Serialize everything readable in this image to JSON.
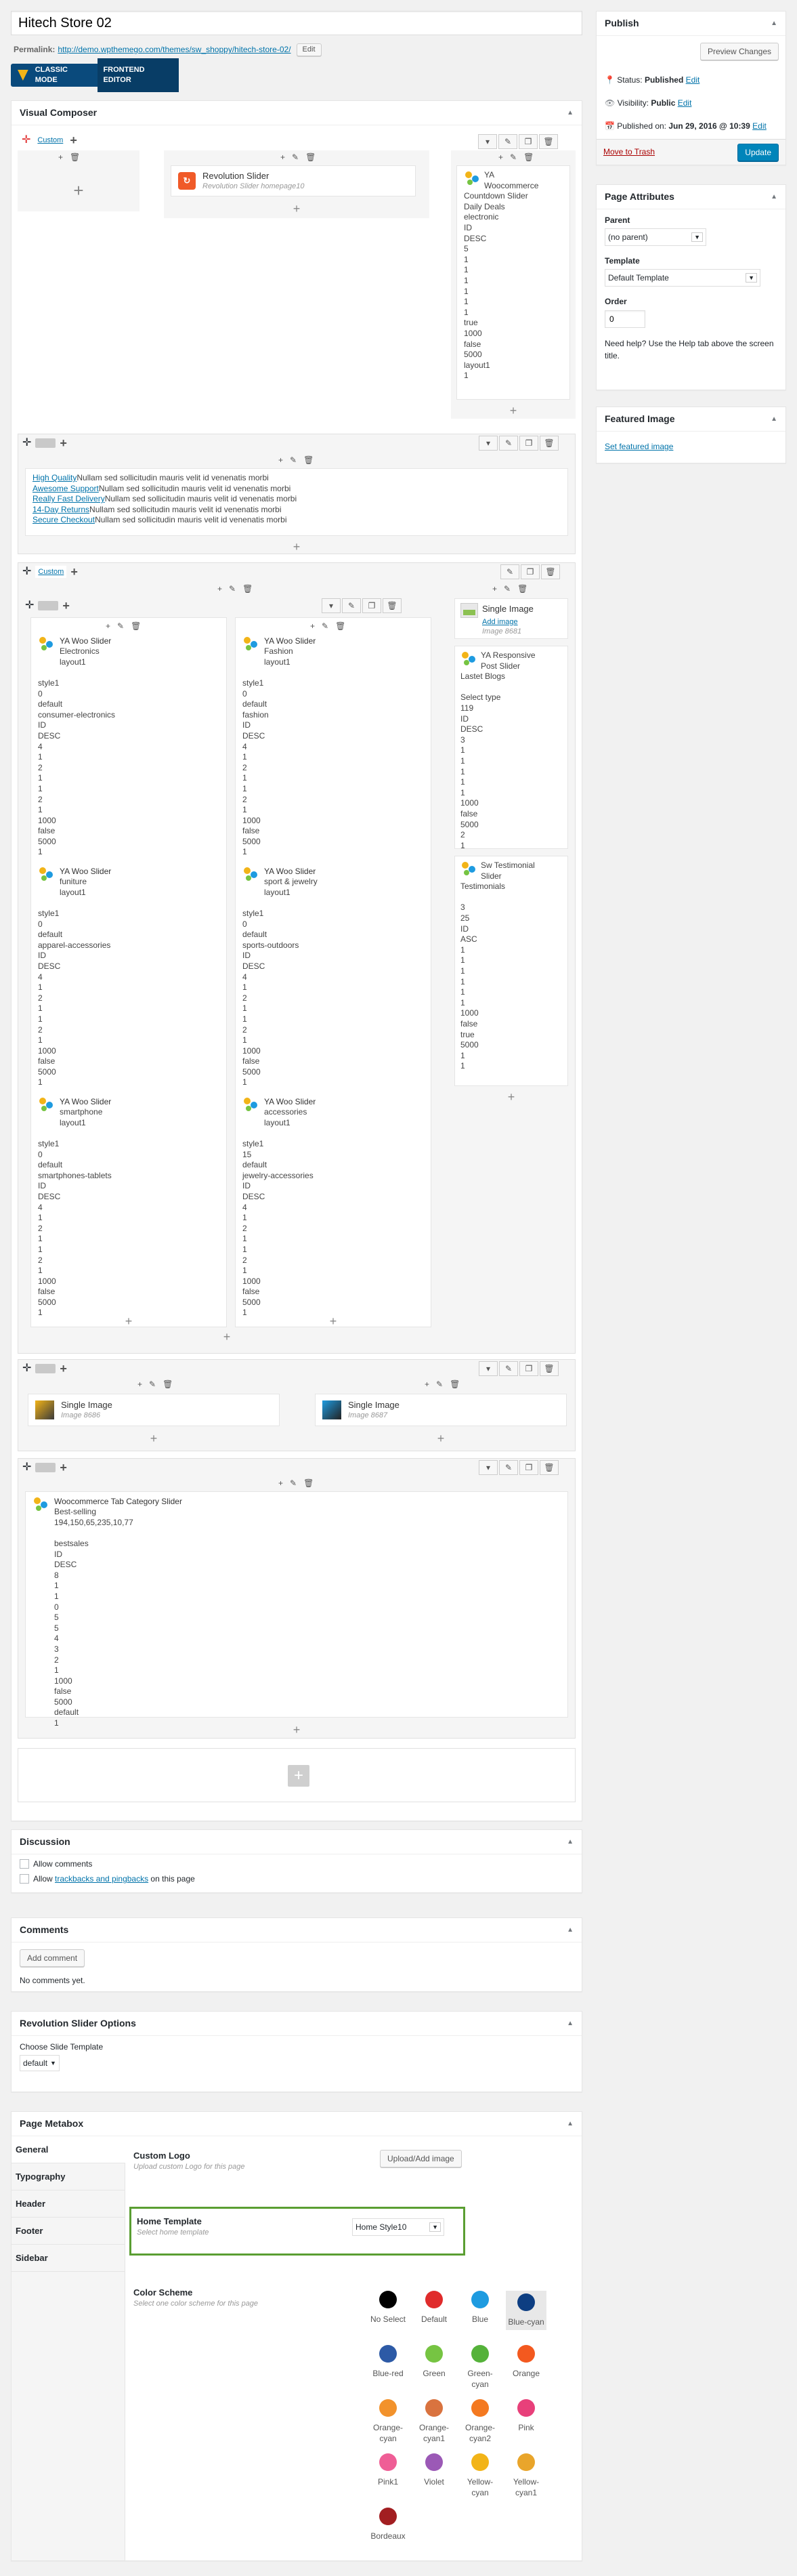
{
  "title": "Hitech Store 02",
  "permalink": {
    "label": "Permalink:",
    "url": "http://demo.wpthemego.com/themes/sw_shoppy/hitech-store-02/",
    "edit": "Edit"
  },
  "modes": {
    "classic": "CLASSIC MODE",
    "frontend": "FRONTEND EDITOR"
  },
  "vc": {
    "title": "Visual Composer",
    "custom": "Custom"
  },
  "row1": {
    "rev": {
      "name": "Revolution Slider",
      "desc": "Revolution Slider homepage10"
    },
    "countdown": {
      "lines": [
        "YA",
        "Woocommerce",
        "Countdown Slider",
        "Daily Deals",
        "electronic",
        "ID",
        "DESC",
        "5",
        "1",
        "1",
        "1",
        "1",
        "1",
        "1",
        "true",
        "1000",
        "false",
        "5000",
        "layout1",
        "1"
      ]
    }
  },
  "row2": {
    "links": [
      {
        "link": "High Quality",
        "text": "Nullam sed sollicitudin mauris velit id venenatis morbi"
      },
      {
        "link": "Awesome Support",
        "text": "Nullam sed sollicitudin mauris velit id venenatis morbi"
      },
      {
        "link": "Really Fast Delivery",
        "text": "Nullam sed sollicitudin mauris velit id venenatis morbi"
      },
      {
        "link": "14-Day Returns",
        "text": "Nullam sed sollicitudin mauris velit id venenatis morbi"
      },
      {
        "link": "Secure Checkout",
        "text": "Nullam sed sollicitudin mauris velit id venenatis morbi"
      }
    ]
  },
  "row3": {
    "custom": "Custom",
    "sliders": [
      {
        "title": "YA Woo Slider",
        "lines": [
          "Electronics",
          "layout1",
          "",
          "style1",
          "0",
          "default",
          "consumer-electronics",
          "ID",
          "DESC",
          "4",
          "1",
          "2",
          "1",
          "1",
          "2",
          "1",
          "1000",
          "false",
          "5000",
          "1"
        ]
      },
      {
        "title": "YA Woo Slider",
        "lines": [
          "Fashion",
          "layout1",
          "",
          "style1",
          "0",
          "default",
          "fashion",
          "ID",
          "DESC",
          "4",
          "1",
          "2",
          "1",
          "1",
          "2",
          "1",
          "1000",
          "false",
          "5000",
          "1"
        ]
      },
      {
        "title": "YA Woo Slider",
        "lines": [
          "funiture",
          "layout1",
          "",
          "style1",
          "0",
          "default",
          "apparel-accessories",
          "ID",
          "DESC",
          "4",
          "1",
          "2",
          "1",
          "1",
          "2",
          "1",
          "1000",
          "false",
          "5000",
          "1"
        ]
      },
      {
        "title": "YA Woo Slider",
        "lines": [
          "sport & jewelry",
          "layout1",
          "",
          "style1",
          "0",
          "default",
          "sports-outdoors",
          "ID",
          "DESC",
          "4",
          "1",
          "2",
          "1",
          "1",
          "2",
          "1",
          "1000",
          "false",
          "5000",
          "1"
        ]
      },
      {
        "title": "YA Woo Slider",
        "lines": [
          "smartphone",
          "layout1",
          "",
          "style1",
          "0",
          "default",
          "smartphones-tablets",
          "ID",
          "DESC",
          "4",
          "1",
          "2",
          "1",
          "1",
          "2",
          "1",
          "1000",
          "false",
          "5000",
          "1"
        ]
      },
      {
        "title": "YA Woo Slider",
        "lines": [
          "accessories",
          "layout1",
          "",
          "style1",
          "15",
          "default",
          "jewelry-accessories",
          "ID",
          "DESC",
          "4",
          "1",
          "2",
          "1",
          "1",
          "2",
          "1",
          "1000",
          "false",
          "5000",
          "1"
        ]
      }
    ],
    "singleimage": {
      "title": "Single Image",
      "add": "Add image",
      "id": "Image 8681"
    },
    "responsive": {
      "lines": [
        "YA Responsive",
        "Post Slider",
        "Lastet Blogs",
        "",
        "Select type",
        "119",
        "ID",
        "DESC",
        "3",
        "1",
        "1",
        "1",
        "1",
        "1",
        "1000",
        "false",
        "5000",
        "2",
        "1"
      ]
    },
    "testimonial": {
      "lines": [
        "Sw Testimonial",
        "Slider",
        "Testimonials",
        "",
        "3",
        "25",
        "ID",
        "ASC",
        "1",
        "1",
        "1",
        "1",
        "1",
        "1",
        "1000",
        "false",
        "true",
        "5000",
        "1",
        "1"
      ]
    }
  },
  "row4": {
    "img1": {
      "title": "Single Image",
      "id": "Image 8686"
    },
    "img2": {
      "title": "Single Image",
      "id": "Image 8687"
    }
  },
  "row5": {
    "title": "Woocommerce Tab Category Slider",
    "lines": [
      "Best-selling",
      "194,150,65,235,10,77",
      "",
      "bestsales",
      "ID",
      "DESC",
      "8",
      "1",
      "1",
      "0",
      "5",
      "5",
      "4",
      "3",
      "2",
      "1",
      "1000",
      "false",
      "5000",
      "default",
      "1"
    ]
  },
  "publish": {
    "title": "Publish",
    "preview": "Preview Changes",
    "status": "Status: ",
    "status_val": "Published",
    "visibility": "Visibility: ",
    "visibility_val": "Public",
    "published": "Published on: ",
    "published_val": "Jun 29, 2016 @ 10:39",
    "edit": "Edit",
    "trash": "Move to Trash",
    "update": "Update"
  },
  "attrs": {
    "title": "Page Attributes",
    "parent": "Parent",
    "parent_val": "(no parent)",
    "template": "Template",
    "template_val": "Default Template",
    "order": "Order",
    "order_val": "0",
    "help": "Need help? Use the Help tab above the screen title."
  },
  "featured": {
    "title": "Featured Image",
    "link": "Set featured image"
  },
  "discussion": {
    "title": "Discussion",
    "c1": "Allow comments",
    "c2a": "Allow ",
    "c2link": "trackbacks and pingbacks",
    "c2b": " on this page"
  },
  "comments": {
    "title": "Comments",
    "add": "Add comment",
    "none": "No comments yet."
  },
  "revopts": {
    "title": "Revolution Slider Options",
    "label": "Choose Slide Template",
    "val": "default"
  },
  "metabox": {
    "title": "Page Metabox",
    "tabs": [
      "General",
      "Typography",
      "Header",
      "Footer",
      "Sidebar"
    ],
    "logo": {
      "label": "Custom Logo",
      "desc": "Upload custom Logo for this page",
      "btn": "Upload/Add image"
    },
    "home": {
      "label": "Home Template",
      "desc": "Select home template",
      "val": "Home Style10"
    },
    "scheme": {
      "label": "Color Scheme",
      "desc": "Select one color scheme for this page",
      "items": [
        {
          "name": "No Select",
          "color": "#000000"
        },
        {
          "name": "Default",
          "color": "#e02b2b"
        },
        {
          "name": "Blue",
          "color": "#1e9be0"
        },
        {
          "name": "Blue-cyan",
          "color": "#0d3e82"
        },
        {
          "name": "Blue-red",
          "color": "#2d5aa6"
        },
        {
          "name": "Green",
          "color": "#76c442"
        },
        {
          "name": "Green-cyan",
          "color": "#55b23a"
        },
        {
          "name": "Orange",
          "color": "#f3591f"
        },
        {
          "name": "Orange-cyan",
          "color": "#f2922c"
        },
        {
          "name": "Orange-cyan1",
          "color": "#d9733f"
        },
        {
          "name": "Orange-cyan2",
          "color": "#f47920"
        },
        {
          "name": "Pink",
          "color": "#e8407a"
        },
        {
          "name": "Pink1",
          "color": "#ef5e96"
        },
        {
          "name": "Violet",
          "color": "#9b59b6"
        },
        {
          "name": "Yellow-cyan",
          "color": "#f2b418"
        },
        {
          "name": "Yellow-cyan1",
          "color": "#e9a52b"
        },
        {
          "name": "Bordeaux",
          "color": "#a21e21"
        }
      ]
    }
  }
}
